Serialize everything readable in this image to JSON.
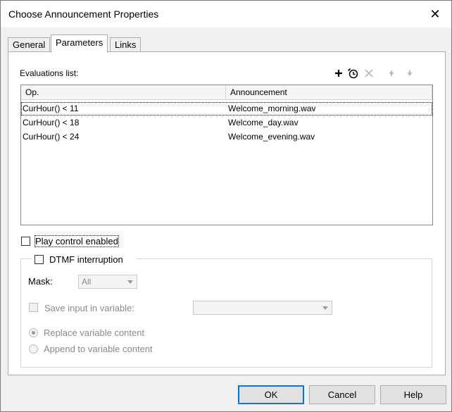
{
  "window": {
    "title": "Choose Announcement Properties",
    "close_glyph": "✕"
  },
  "tabs": [
    {
      "label": "General",
      "active": false
    },
    {
      "label": "Parameters",
      "active": true
    },
    {
      "label": "Links",
      "active": false
    }
  ],
  "evaluations": {
    "label": "Evaluations list:",
    "toolbar": [
      {
        "icon": "add-icon",
        "enabled": true
      },
      {
        "icon": "edit-clock-icon",
        "enabled": true
      },
      {
        "icon": "delete-icon",
        "enabled": false
      },
      {
        "icon": "move-up-icon",
        "enabled": false
      },
      {
        "icon": "move-down-icon",
        "enabled": false
      }
    ],
    "columns": [
      "Op.",
      "Announcement"
    ],
    "rows": [
      {
        "op": "CurHour() < 11",
        "announcement": "Welcome_morning.wav"
      },
      {
        "op": "CurHour() < 18",
        "announcement": "Welcome_day.wav"
      },
      {
        "op": "CurHour() < 24",
        "announcement": "Welcome_evening.wav"
      }
    ]
  },
  "play_control": {
    "label": "Play control enabled",
    "checked": false
  },
  "dtmf": {
    "label": "DTMF interruption",
    "checked": false,
    "mask_label": "Mask:",
    "mask_value": "All",
    "save_input_label": "Save input in variable:",
    "save_input_value": "",
    "replace_label": "Replace variable content",
    "append_label": "Append to variable content"
  },
  "buttons": {
    "ok": "OK",
    "cancel": "Cancel",
    "help": "Help"
  }
}
